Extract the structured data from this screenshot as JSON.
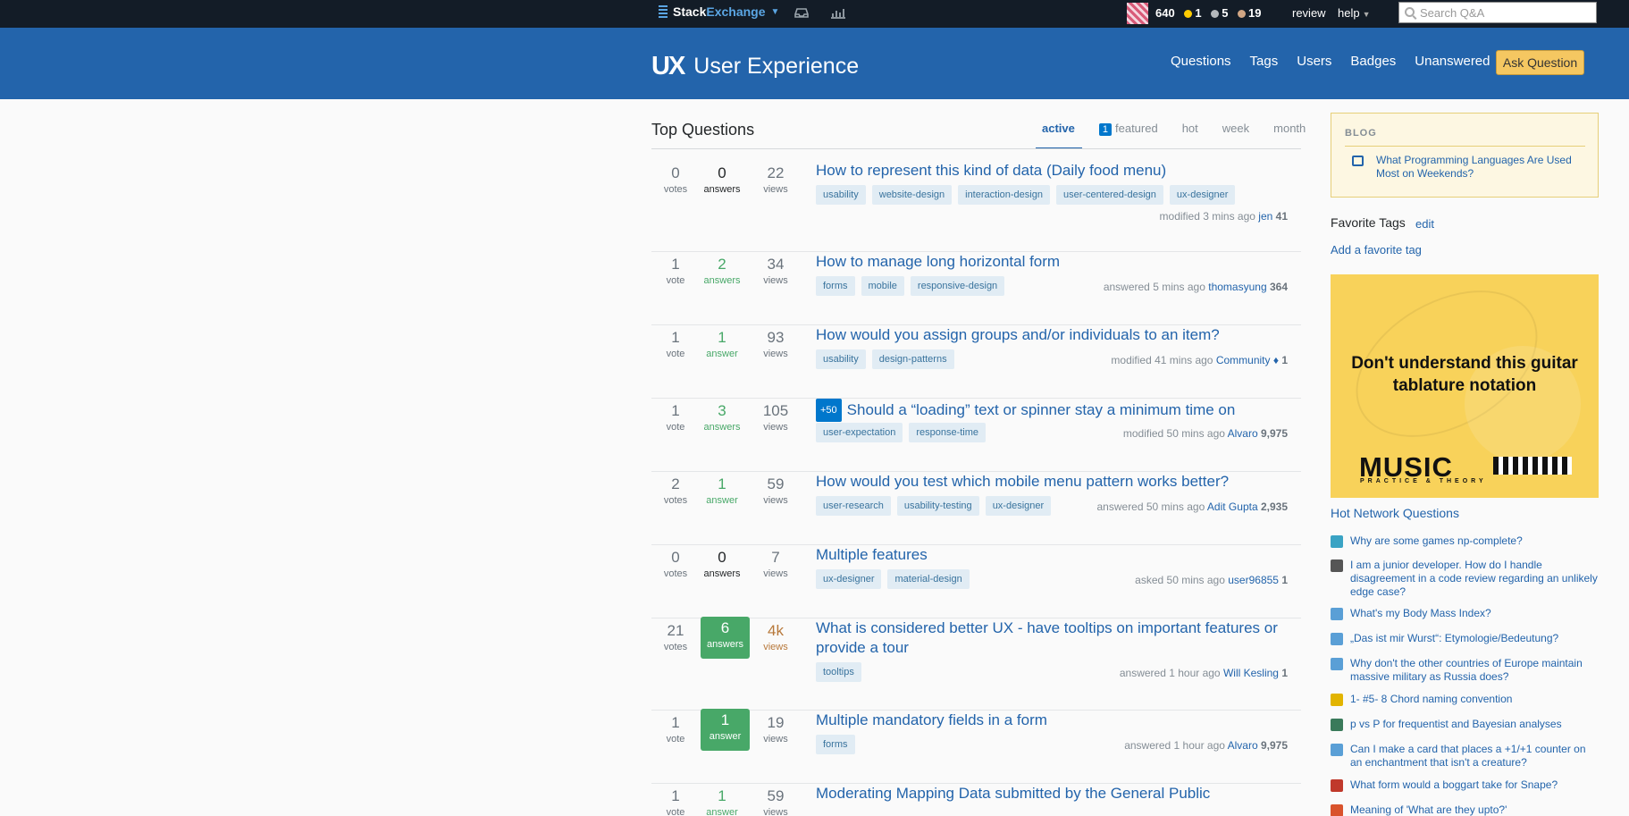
{
  "topbar": {
    "network_name_a": "Stack",
    "network_name_b": "Exchange",
    "reputation": "640",
    "gold": "1",
    "silver": "5",
    "bronze": "19",
    "review": "review",
    "help": "help",
    "search_placeholder": "Search Q&A",
    "icons": [
      "stackexchange-icon",
      "inbox-icon",
      "achievements-icon",
      "search-icon"
    ]
  },
  "header": {
    "logo_mark": "UX",
    "site_name": "User Experience",
    "nav": [
      "Questions",
      "Tags",
      "Users",
      "Badges",
      "Unanswered"
    ],
    "ask_button": "Ask Question",
    "colors": {
      "header": "#2364ab",
      "topbar": "#131c27",
      "accent": "#f5c761"
    }
  },
  "main": {
    "title": "Top Questions",
    "tabs": [
      {
        "label": "active"
      },
      {
        "count": "1",
        "label": "featured"
      },
      {
        "label": "hot"
      },
      {
        "label": "week"
      },
      {
        "label": "month"
      }
    ],
    "questions": [
      {
        "votes": "0",
        "votes_label": "votes",
        "answers": "0",
        "answers_label": "answers",
        "views": "22",
        "views_label": "views",
        "title": "How to represent this kind of data (Daily food menu)",
        "tags": [
          "usability",
          "website-design",
          "interaction-design",
          "user-centered-design",
          "ux-designer"
        ],
        "action": "modified 3 mins ago",
        "user": "jen",
        "rep": "41"
      },
      {
        "votes": "1",
        "votes_label": "vote",
        "answers": "2",
        "answers_label": "answers",
        "views": "34",
        "views_label": "views",
        "title": "How to manage long horizontal form",
        "tags": [
          "forms",
          "mobile",
          "responsive-design"
        ],
        "action": "answered 5 mins ago",
        "user": "thomasyung",
        "rep": "364"
      },
      {
        "votes": "1",
        "votes_label": "vote",
        "answers": "1",
        "answers_label": "answer",
        "views": "93",
        "views_label": "views",
        "title": "How would you assign groups and/or individuals to an item?",
        "tags": [
          "usability",
          "design-patterns"
        ],
        "action": "modified 41 mins ago",
        "user": "Community ♦",
        "rep": "1"
      },
      {
        "votes": "1",
        "votes_label": "vote",
        "answers": "3",
        "answers_label": "answers",
        "views": "105",
        "views_label": "views",
        "bounty": "+50",
        "title": "Should a “loading” text or spinner stay a minimum time on screen?",
        "tags": [
          "user-expectation",
          "response-time"
        ],
        "action": "modified 50 mins ago",
        "user": "Alvaro",
        "rep": "9,975"
      },
      {
        "votes": "2",
        "votes_label": "votes",
        "answers": "1",
        "answers_label": "answer",
        "views": "59",
        "views_label": "views",
        "title": "How would you test which mobile menu pattern works better?",
        "tags": [
          "user-research",
          "usability-testing",
          "ux-designer"
        ],
        "action": "answered 50 mins ago",
        "user": "Adit Gupta",
        "rep": "2,935"
      },
      {
        "votes": "0",
        "votes_label": "votes",
        "answers": "0",
        "answers_label": "answers",
        "views": "7",
        "views_label": "views",
        "title": "Multiple features",
        "tags": [
          "ux-designer",
          "material-design"
        ],
        "action": "asked 50 mins ago",
        "user": "user96855",
        "rep": "1"
      },
      {
        "votes": "21",
        "votes_label": "votes",
        "answers": "6",
        "answers_label": "answers",
        "views": "4k",
        "views_label": "views",
        "title": "What is considered better UX - have tooltips on important features or provide a tour",
        "tags": [
          "tooltips"
        ],
        "action": "answered 1 hour ago",
        "user": "Will Kesling",
        "rep": "1"
      },
      {
        "votes": "1",
        "votes_label": "vote",
        "answers": "1",
        "answers_label": "answer",
        "views": "19",
        "views_label": "views",
        "title": "Multiple mandatory fields in a form",
        "tags": [
          "forms"
        ],
        "action": "answered 1 hour ago",
        "user": "Alvaro",
        "rep": "9,975"
      },
      {
        "votes": "1",
        "votes_label": "vote",
        "answers": "1",
        "answers_label": "answer",
        "views": "59",
        "views_label": "views",
        "title": "Moderating Mapping Data submitted by the General Public",
        "tags": [],
        "action": "",
        "user": "",
        "rep": ""
      }
    ]
  },
  "sidebar": {
    "blog_heading": "BLOG",
    "blog_post": "What Programming Languages Are Used Most on Weekends?",
    "fav_title": "Favorite Tags",
    "fav_edit": "edit",
    "fav_add": "Add a favorite tag",
    "ad_headline": "Don't understand this guitar tablature notation",
    "ad_brand": "MUSIC",
    "ad_sub": "PRACTICE & THEORY",
    "hnq_title": "Hot Network Questions",
    "hnq": [
      {
        "text": "Why are some games np-complete?",
        "color": "#3aa3c4"
      },
      {
        "text": "I am a junior developer. How do I handle disagreement in a code review regarding an unlikely edge case?",
        "color": "#555555"
      },
      {
        "text": "What's my Body Mass Index?",
        "color": "#5a9fd6"
      },
      {
        "text": "„Das ist mir Wurst“: Etymologie/Bedeutung?",
        "color": "#5a9fd6"
      },
      {
        "text": "Why don't the other countries of Europe maintain massive military as Russia does?",
        "color": "#5a9fd6"
      },
      {
        "text": "1- #5- 8 Chord naming convention",
        "color": "#e2b400"
      },
      {
        "text": "p vs P for frequentist and Bayesian analyses",
        "color": "#3a7a5a"
      },
      {
        "text": "Can I make a card that places a +1/+1 counter on an enchantment that isn't a creature?",
        "color": "#5a9fd6"
      },
      {
        "text": "What form would a boggart take for Snape?",
        "color": "#c0392b"
      },
      {
        "text": "Meaning of 'What are they upto?'",
        "color": "#d9532c"
      }
    ]
  }
}
